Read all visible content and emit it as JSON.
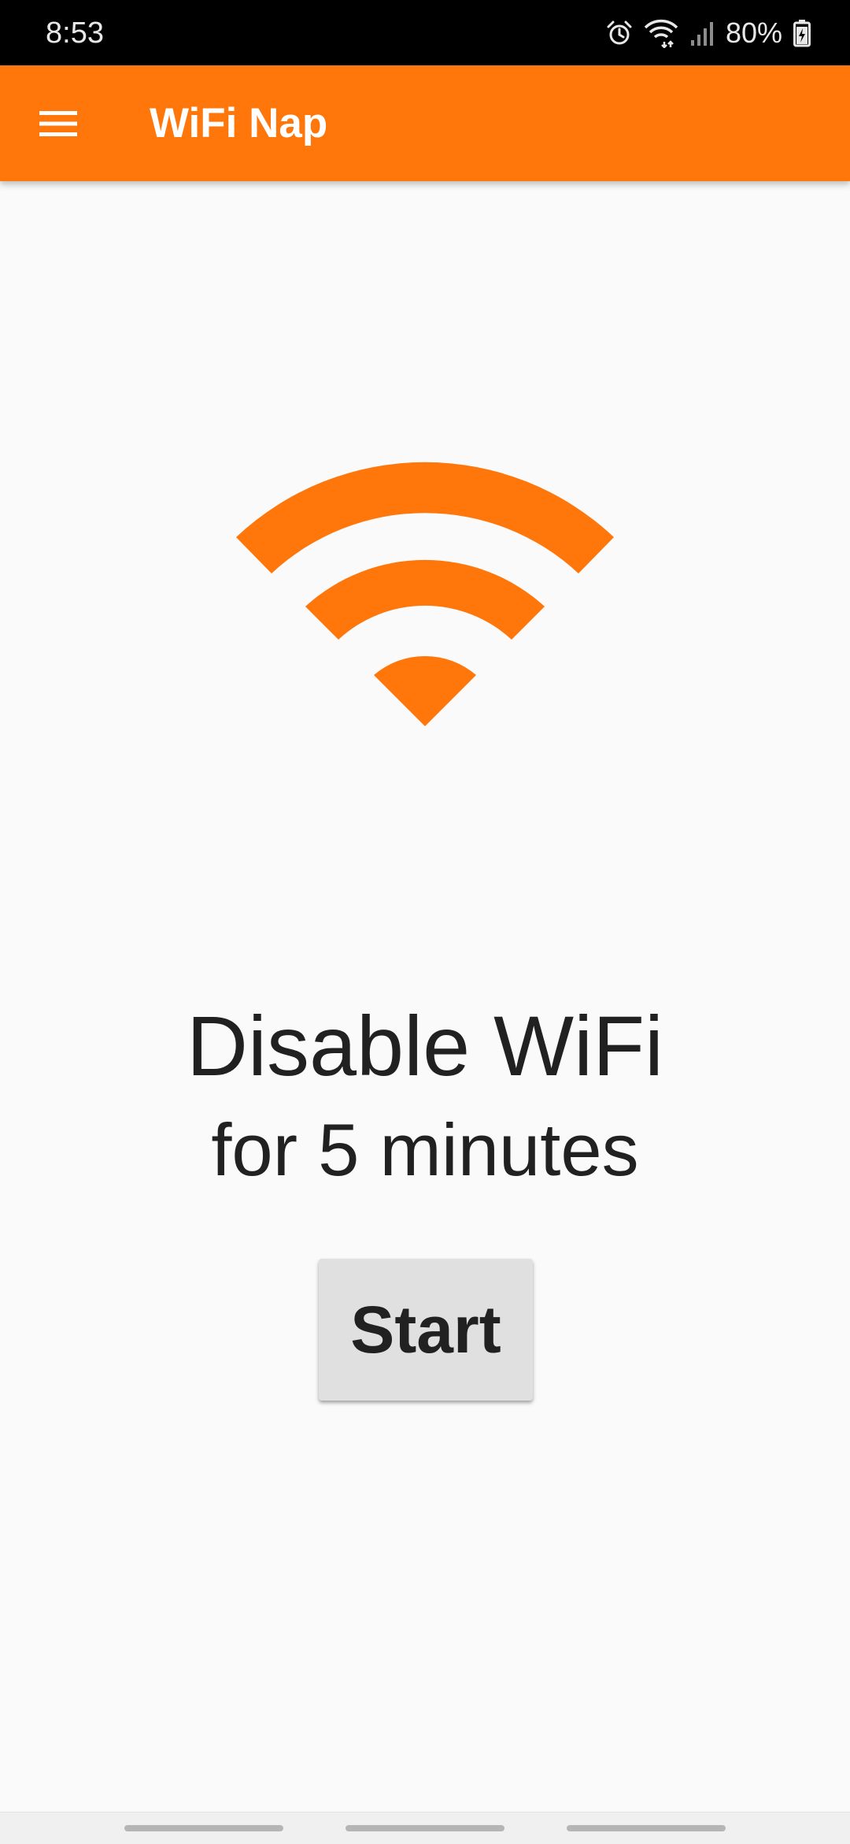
{
  "status_bar": {
    "time": "8:53",
    "battery": "80%",
    "icons": [
      "alarm-icon",
      "wifi-icon",
      "signal-icon",
      "battery-charging-icon"
    ]
  },
  "app_bar": {
    "title": "WiFi Nap",
    "menu_icon": "hamburger-menu-icon"
  },
  "main": {
    "graphic_icon": "wifi-icon",
    "headline": "Disable WiFi",
    "subline": "for 5 minutes",
    "start_label": "Start"
  },
  "nav_bar": {
    "handles": [
      "recent-apps",
      "home",
      "back"
    ]
  },
  "colors": {
    "accent": "#ff760a",
    "background": "#fafafa",
    "status_bar": "#000000",
    "button": "#e0e0e0",
    "text": "#212121"
  }
}
